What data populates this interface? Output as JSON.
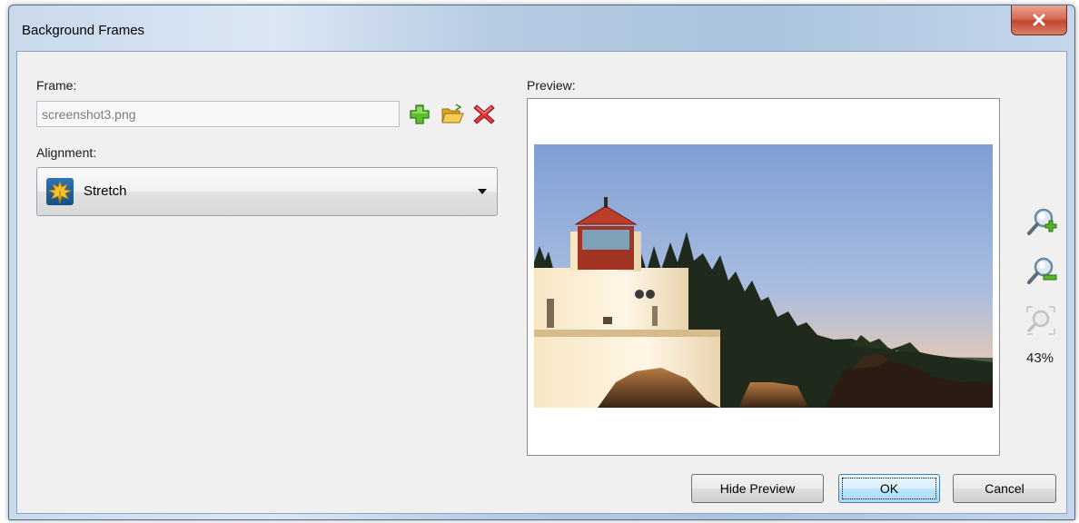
{
  "window": {
    "title": "Background Frames",
    "close_glyph": "X"
  },
  "frame": {
    "label": "Frame:",
    "value": "screenshot3.png",
    "add_icon": "add-icon",
    "open_icon": "open-folder-icon",
    "remove_icon": "delete-icon"
  },
  "alignment": {
    "label": "Alignment:",
    "selected": "Stretch",
    "icon": "image-stretch-icon"
  },
  "preview": {
    "label": "Preview:",
    "zoom_in_icon": "zoom-in-icon",
    "zoom_out_icon": "zoom-out-icon",
    "zoom_fit_icon": "zoom-fit-icon",
    "zoom_percent": "43%"
  },
  "buttons": {
    "hide_preview": "Hide Preview",
    "ok": "OK",
    "cancel": "Cancel"
  },
  "colors": {
    "dialog_bg": "#f0f0f0",
    "title_bar": "#aac3df",
    "close_red": "#c2462d",
    "add_green": "#4cae22",
    "delete_red": "#d9262b",
    "folder_yellow": "#e9b93a"
  }
}
